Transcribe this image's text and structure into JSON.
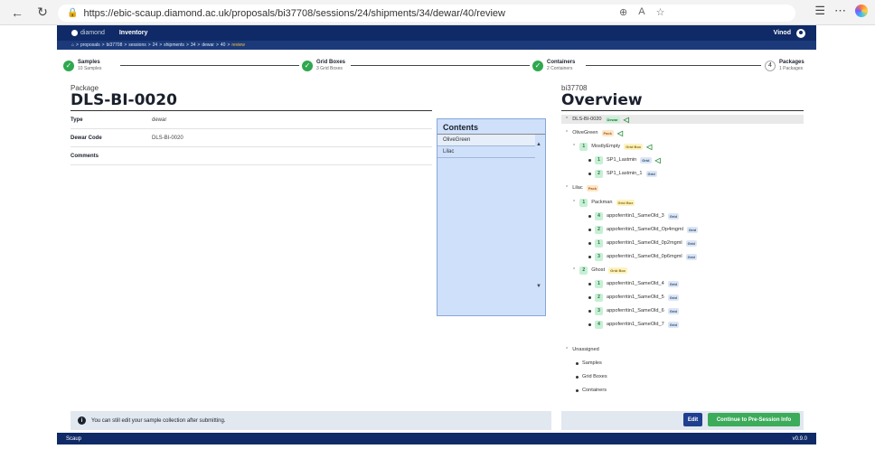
{
  "browser": {
    "url": "https://ebic-scaup.diamond.ac.uk/proposals/bi37708/sessions/24/shipments/34/dewar/40/review",
    "back_icon": "arrow-left-icon",
    "refresh_icon": "refresh-icon"
  },
  "header": {
    "logo_text": "diamond",
    "nav_inventory": "Inventory",
    "user": "Vinod"
  },
  "breadcrumb": {
    "items": [
      "proposals",
      "bi37708",
      "sessions",
      "24",
      "shipments",
      "34",
      "dewar",
      "40"
    ],
    "current": "review",
    "separator": ">"
  },
  "steps": [
    {
      "title": "Samples",
      "sub": "10 Samples",
      "done": true
    },
    {
      "title": "Grid Boxes",
      "sub": "3 Grid Boxes",
      "done": true
    },
    {
      "title": "Containers",
      "sub": "2 Containers",
      "done": true
    },
    {
      "title": "Packages",
      "sub": "1 Packages",
      "number": "4",
      "done": false
    }
  ],
  "package": {
    "small_label": "Package",
    "name": "DLS-BI-0020",
    "fields": [
      {
        "key": "Type",
        "value": "dewar"
      },
      {
        "key": "Dewar Code",
        "value": "DLS-BI-0020"
      },
      {
        "key": "Comments",
        "value": ""
      }
    ]
  },
  "contents": {
    "title": "Contents",
    "items": [
      "OliveGreen",
      "Lilac"
    ]
  },
  "overview": {
    "proposal": "bi37708",
    "title": "Overview",
    "root": {
      "label": "DLS-BI-0020",
      "tag": "Dewar"
    },
    "rows": [
      {
        "label": "OliveGreen",
        "tag": "Pack"
      },
      {
        "label": "MostlyEmpty",
        "tag": "Grid Box",
        "num": "1"
      },
      {
        "label": "SP1_Lastmin",
        "tag": "Grid",
        "num": "1"
      },
      {
        "label": "SP1_Lastmin_1",
        "tag": "Grid",
        "num": "2"
      },
      {
        "label": "Lilac",
        "tag": "Pack"
      },
      {
        "label": "Packman",
        "tag": "Grid Box",
        "num": "1"
      },
      {
        "label": "appoferritin1_SameOld_3",
        "tag": "Grid",
        "num": "4"
      },
      {
        "label": "appoferritin1_SameOld_Op4mgml",
        "tag": "Grid",
        "num": "2"
      },
      {
        "label": "appoferritin1_SameOld_0p2mgml",
        "tag": "Grid",
        "num": "1"
      },
      {
        "label": "appoferritin1_SameOld_0p6mgml",
        "tag": "Grid",
        "num": "3"
      },
      {
        "label": "Ghost",
        "tag": "Grid Box",
        "num": "2"
      },
      {
        "label": "appoferritin1_SameOld_4",
        "tag": "Grid",
        "num": "1"
      },
      {
        "label": "appoferritin1_SameOld_5",
        "tag": "Grid",
        "num": "2"
      },
      {
        "label": "appoferritin1_SameOld_6",
        "tag": "Grid",
        "num": "3"
      },
      {
        "label": "appoferritin1_SameOld_7",
        "tag": "Grid",
        "num": "4"
      }
    ],
    "unassigned": {
      "label": "Unassigned",
      "items": [
        "Samples",
        "Grid Boxes",
        "Containers"
      ]
    }
  },
  "footer": {
    "info_text": "You can still edit your sample collection after submitting.",
    "edit_label": "Edit",
    "continue_label": "Continue to Pre-Session Info",
    "app_name": "Scaup",
    "version": "v0.9.0"
  }
}
